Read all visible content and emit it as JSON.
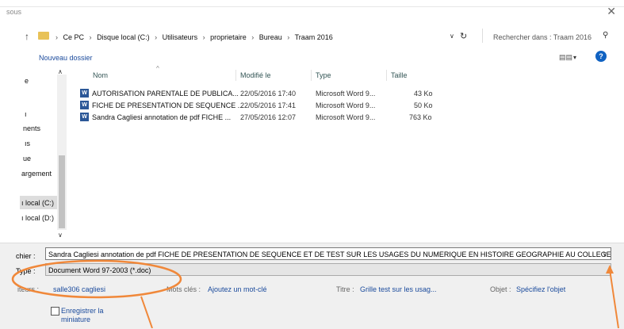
{
  "window": {
    "title_fragment": "sous",
    "close_glyph": "✕"
  },
  "address": {
    "crumbs": [
      "Ce PC",
      "Disque local (C:)",
      "Utilisateurs",
      "proprietaire",
      "Bureau",
      "Traam 2016"
    ],
    "search_placeholder": "Rechercher dans : Traam 2016"
  },
  "toolbar": {
    "new_folder": "Nouveau dossier",
    "help": "?"
  },
  "nav": {
    "items": [
      "e",
      "ı",
      "nents",
      "ıs",
      "ue",
      "argement",
      "ı local (C:)",
      "ı local (D:)"
    ]
  },
  "columns": {
    "name": "Nom",
    "modified": "Modifié le",
    "type": "Type",
    "size": "Taille"
  },
  "files": [
    {
      "name": "AUTORISATION PARENTALE DE PUBLICA...",
      "modified": "22/05/2016 17:40",
      "type": "Microsoft Word 9...",
      "size": "43 Ko"
    },
    {
      "name": "FICHE DE PRESENTATION DE SEQUENCE ...",
      "modified": "22/05/2016 17:41",
      "type": "Microsoft Word 9...",
      "size": "50 Ko"
    },
    {
      "name": "Sandra Cagliesi annotation de pdf FICHE ...",
      "modified": "27/05/2016 12:07",
      "type": "Microsoft Word 9...",
      "size": "763 Ko"
    }
  ],
  "save": {
    "filename_label": "chier :",
    "filename_value": "Sandra Cagliesi annotation de pdf FICHE DE PRESENTATION DE SEQUENCE ET DE TEST SUR LES USAGES DU NUMERIQUE EN HISTOIRE GEOGRAPHIE AU COLLEGE, LYCEE",
    "type_label": "Type :",
    "type_value": "Document Word 97-2003 (*.doc)",
    "authors_label": "iteurs :",
    "authors_value": "salle306 cagliesi",
    "keywords_label": "Mots clés :",
    "keywords_value": "Ajoutez un mot-clé",
    "title_label": "Titre :",
    "title_value": "Grille test sur les usag...",
    "subject_label": "Objet :",
    "subject_value": "Spécifiez l'objet",
    "thumbnail_label": "Enregistrer la miniature"
  },
  "annotation_color": "#f0883a"
}
